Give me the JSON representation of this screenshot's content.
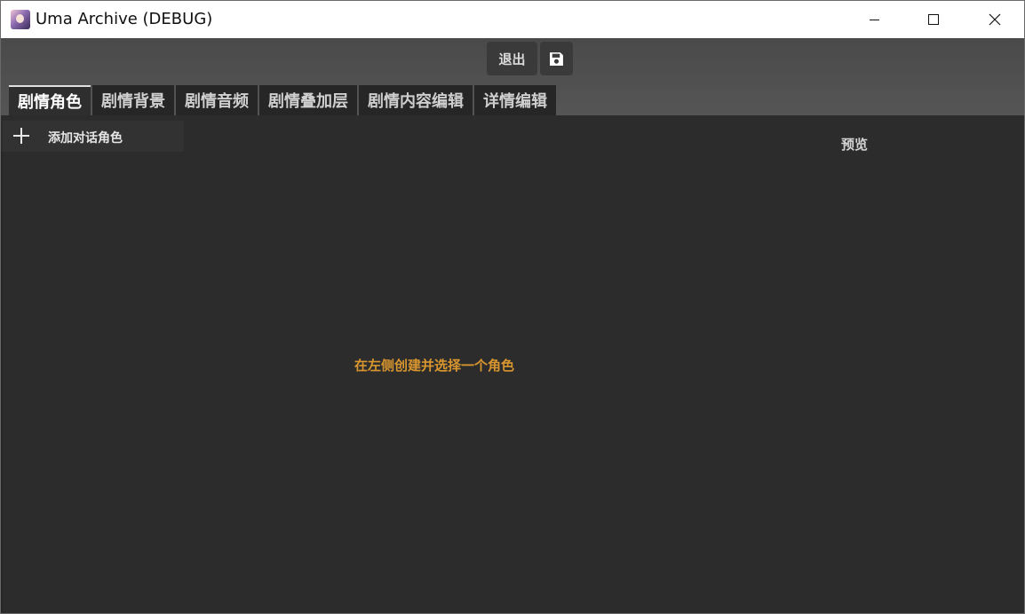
{
  "window": {
    "title": "Uma Archive (DEBUG)",
    "app_icon": "app-icon",
    "controls": [
      "minimize-icon",
      "maximize-icon",
      "close-icon"
    ]
  },
  "toolbar": {
    "exit_label": "退出",
    "save_icon": "save-icon"
  },
  "tabs": [
    {
      "label": "剧情角色",
      "active": true
    },
    {
      "label": "剧情背景",
      "active": false
    },
    {
      "label": "剧情音频",
      "active": false
    },
    {
      "label": "剧情叠加层",
      "active": false
    },
    {
      "label": "剧情内容编辑",
      "active": false
    },
    {
      "label": "详情编辑",
      "active": false
    }
  ],
  "sidebar": {
    "add_label": "添加对话角色",
    "add_icon": "plus-icon"
  },
  "preview": {
    "label": "预览"
  },
  "main": {
    "empty_hint": "在左侧创建并选择一个角色"
  },
  "colors": {
    "hint": "#d9962f",
    "background": "#2c2c2c",
    "header": "#505050"
  }
}
